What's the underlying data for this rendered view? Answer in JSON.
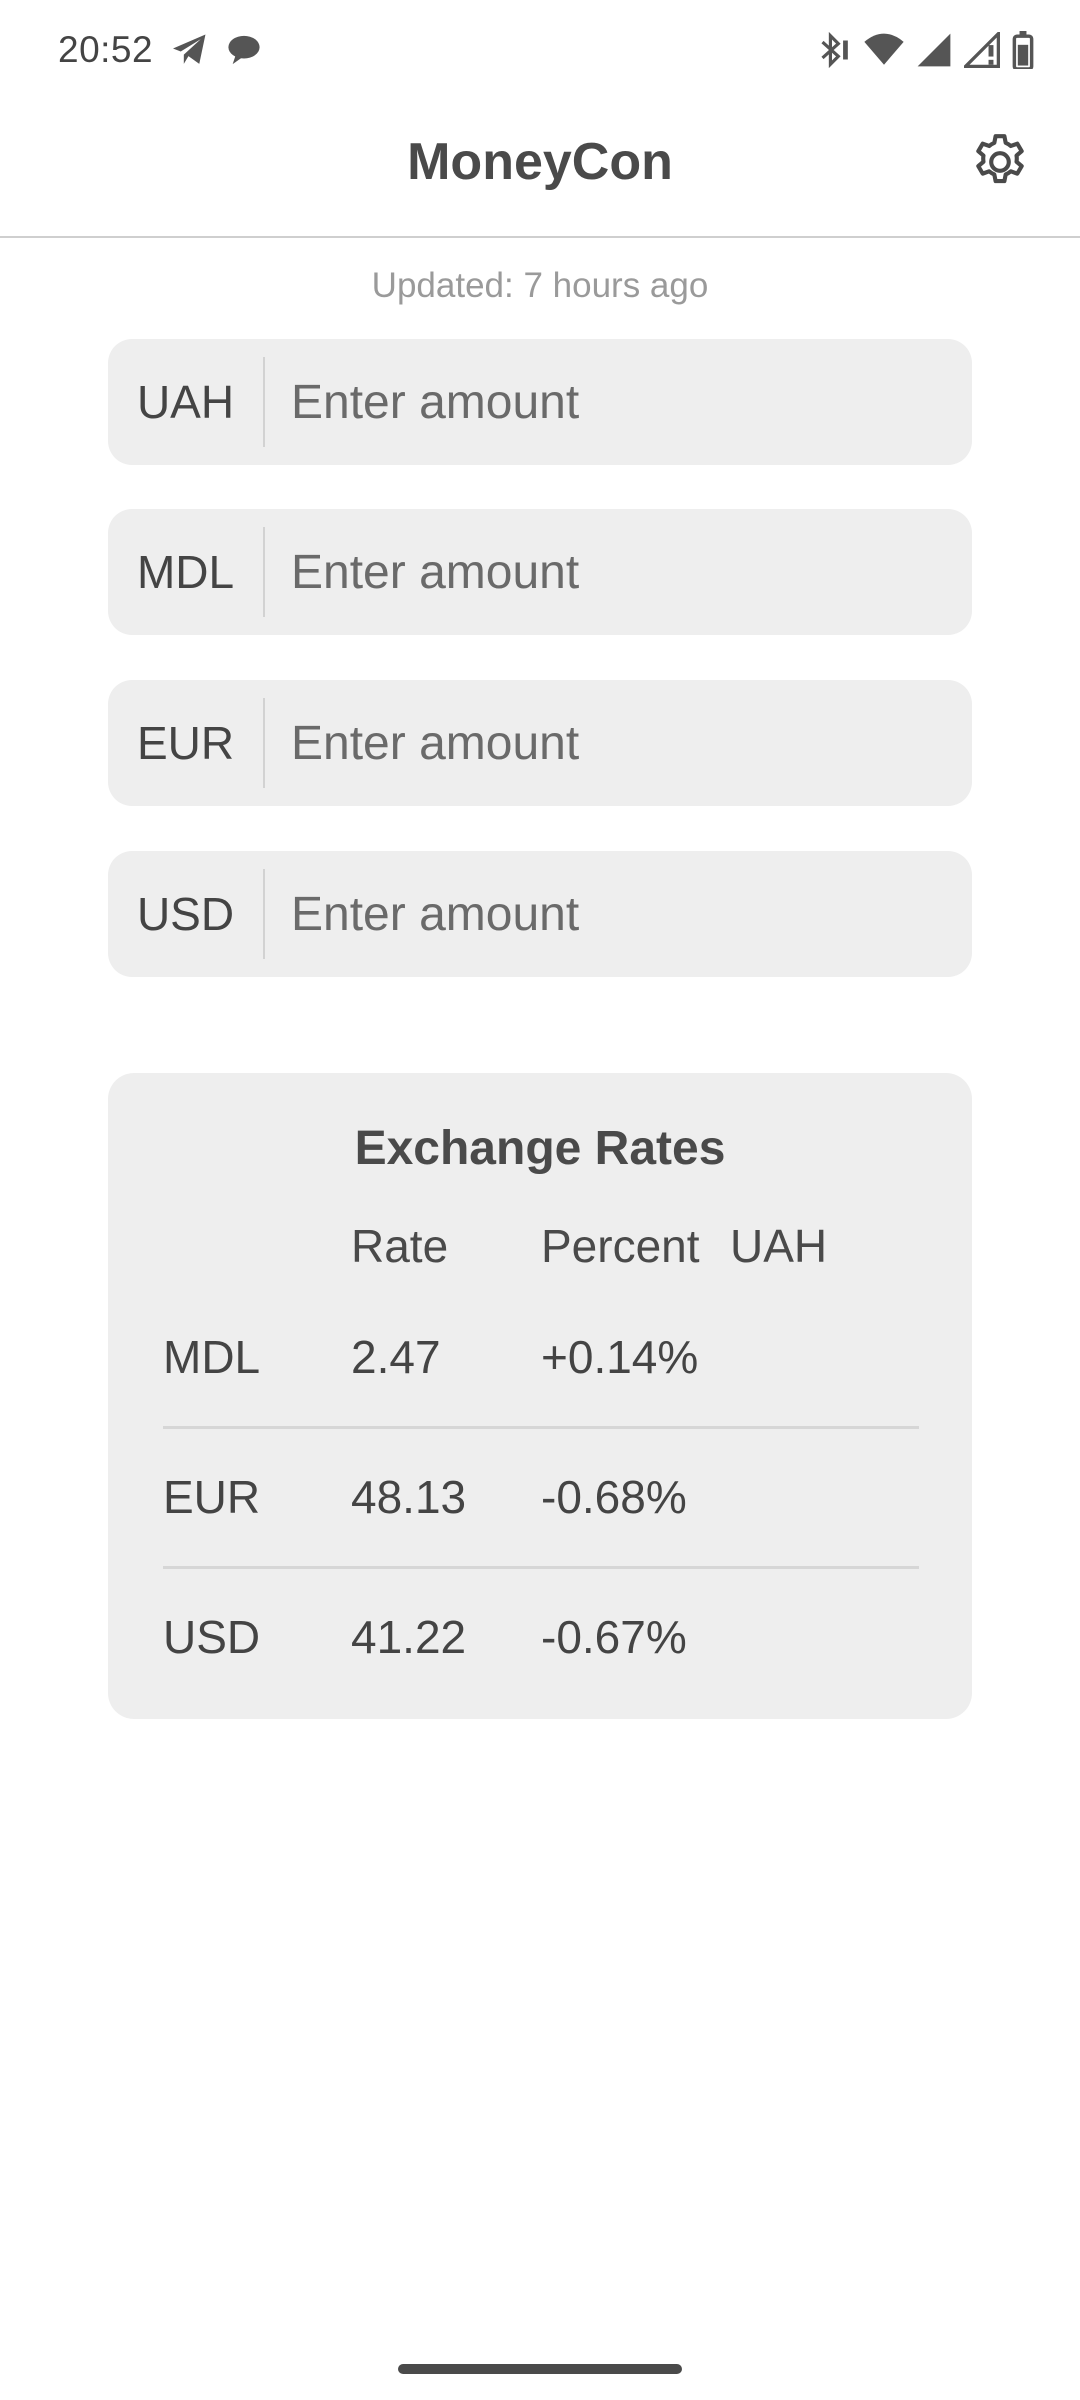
{
  "status_bar": {
    "time": "20:52",
    "left_icons": [
      "telegram-icon",
      "chat-bubble-icon"
    ],
    "right_icons": [
      "bluetooth-icon",
      "wifi-icon",
      "cell-signal-icon",
      "cell-signal-no-data-icon",
      "battery-icon"
    ]
  },
  "app_bar": {
    "title": "MoneyCon",
    "settings_icon": "gear-icon"
  },
  "updated_text": "Updated: 7 hours ago",
  "currencies": [
    {
      "code": "UAH",
      "placeholder": "Enter amount",
      "value": ""
    },
    {
      "code": "MDL",
      "placeholder": "Enter amount",
      "value": ""
    },
    {
      "code": "EUR",
      "placeholder": "Enter amount",
      "value": ""
    },
    {
      "code": "USD",
      "placeholder": "Enter amount",
      "value": ""
    }
  ],
  "rates": {
    "title": "Exchange Rates",
    "headers": {
      "rate": "Rate",
      "percent": "Percent",
      "base": "UAH"
    },
    "rows": [
      {
        "currency": "MDL",
        "rate": "2.47",
        "percent": "+0.14%"
      },
      {
        "currency": "EUR",
        "rate": "48.13",
        "percent": "-0.68%"
      },
      {
        "currency": "USD",
        "rate": "41.22",
        "percent": "-0.67%"
      }
    ]
  },
  "colors": {
    "text": "#444444",
    "card_background": "#eeeeee",
    "divider": "#d6d6d6",
    "muted_text": "#9a9a9a"
  }
}
